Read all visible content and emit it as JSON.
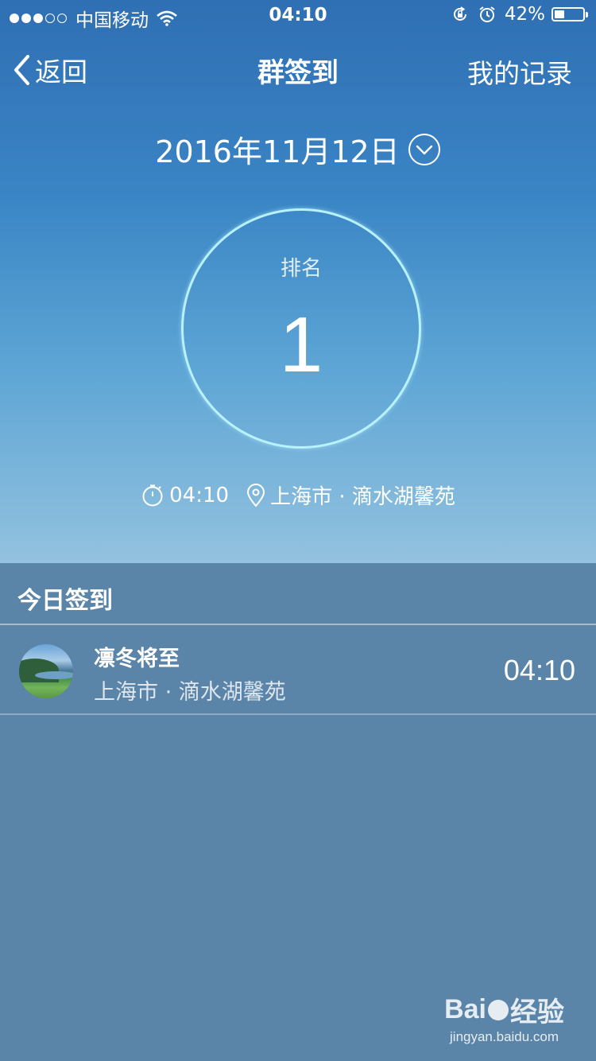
{
  "status_bar": {
    "carrier": "中国移动",
    "time": "04:10",
    "battery": "42%",
    "battery_level": 0.42,
    "signal_filled": 3,
    "signal_total": 5
  },
  "nav": {
    "back_label": "返回",
    "title": "群签到",
    "right_label": "我的记录"
  },
  "date": {
    "label": "2016年11月12日",
    "icon": "chevron-down-circle-icon"
  },
  "rank": {
    "label": "排名",
    "value": "1"
  },
  "checkin": {
    "time": "04:10",
    "location": "上海市 · 滴水湖馨苑"
  },
  "today_section": {
    "title": "今日签到",
    "items": [
      {
        "name": "凛冬将至",
        "location": "上海市 · 滴水湖馨苑",
        "time": "04:10"
      }
    ]
  },
  "watermark": {
    "logo": "Bai经验",
    "url": "jingyan.baidu.com"
  },
  "colors": {
    "header_top": "#2f6fb3",
    "header_bottom": "#93c2df",
    "body_bg": "#5a84a8",
    "ring": "#b8f2ff"
  }
}
